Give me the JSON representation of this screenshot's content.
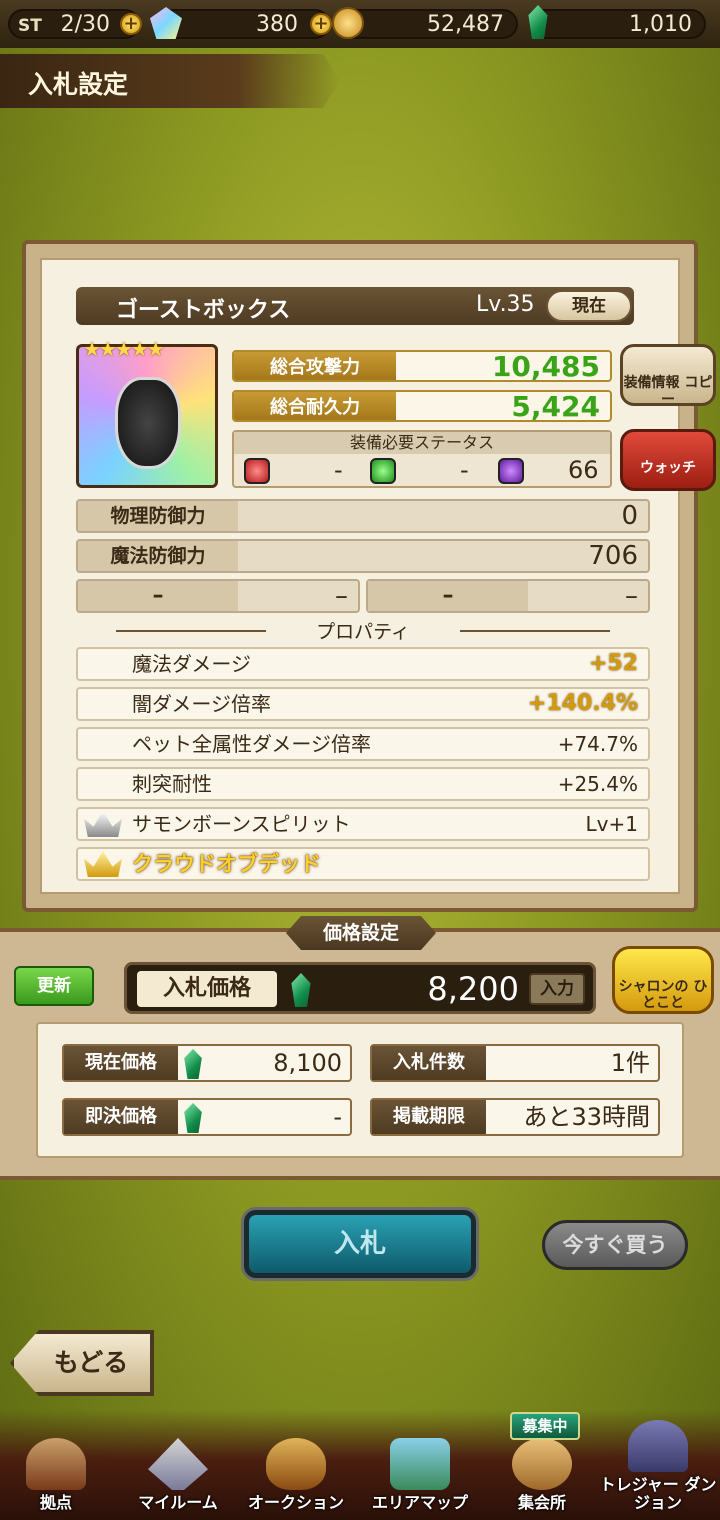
{
  "status_bar": {
    "stamina_label": "ST",
    "stamina_value": "2/30",
    "gems": "380",
    "gold": "52,487",
    "emeralds": "1,010"
  },
  "page_title": "入札設定",
  "item": {
    "name": "ゴーストボックス",
    "level": "Lv.35",
    "current_label": "現在",
    "stars": "★★★★★",
    "attack_label": "総合攻撃力",
    "attack_value": "10,485",
    "durability_label": "総合耐久力",
    "durability_value": "5,424",
    "req_header": "装備必要ステータス",
    "req_values": [
      "-",
      "-",
      "66"
    ],
    "copy_button": "装備情報 コピー",
    "watch_button": "ウォッチ",
    "phys_def_label": "物理防御力",
    "phys_def_value": "0",
    "mag_def_label": "魔法防御力",
    "mag_def_value": "706",
    "empty_left_label": "–",
    "empty_left_value": "–",
    "empty_right_label": "–",
    "empty_right_value": "–",
    "property_header": "プロパティ",
    "properties": [
      {
        "label": "魔法ダメージ",
        "value": "+52"
      },
      {
        "label": "闇ダメージ倍率",
        "value": "+140.4%"
      },
      {
        "label": "ペット全属性ダメージ倍率",
        "value": "+74.7%"
      },
      {
        "label": "刺突耐性",
        "value": "+25.4%"
      },
      {
        "label": "サモンボーンスピリット",
        "value": "Lv+1"
      },
      {
        "label": "クラウドオブデッド",
        "value": ""
      }
    ]
  },
  "price": {
    "section_title": "価格設定",
    "refresh_button": "更新",
    "bid_label": "入札価格",
    "bid_value": "8,200",
    "input_button": "入力",
    "sharon_button": "シャロンの ひとこと",
    "current_price_label": "現在価格",
    "current_price_value": "8,100",
    "bid_count_label": "入札件数",
    "bid_count_value": "1件",
    "buyout_label": "即決価格",
    "buyout_value": "-",
    "deadline_label": "掲載期限",
    "deadline_value": "あと33時間"
  },
  "actions": {
    "bid_button": "入札",
    "buy_now_button": "今すぐ買う",
    "back_button": "もどる"
  },
  "nav": {
    "items": [
      "拠点",
      "マイルーム",
      "オークション",
      "エリアマップ",
      "集会所",
      "トレジャー ダンジョン"
    ],
    "recruit_badge": "募集中"
  }
}
